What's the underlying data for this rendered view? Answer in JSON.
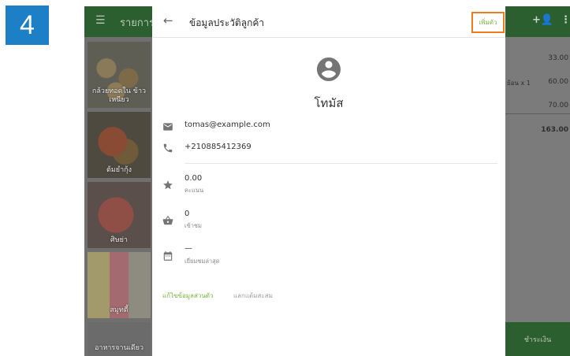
{
  "step_badge": "4",
  "background": {
    "menu_icon": "hamburger-icon",
    "title": "รายการ",
    "add_user_icon": "person-add-icon",
    "more_icon": "more-vertical-icon",
    "menu_items": [
      {
        "label": "กล้วยทอดใน ข้าวเหนียว"
      },
      {
        "label": "ต้มยำกุ้ง"
      },
      {
        "label": "ศิษย่า"
      },
      {
        "label": "สมูทตี้"
      },
      {
        "label": "อาหารจานเดียว"
      }
    ],
    "order_lines": [
      {
        "price": "33.00"
      },
      {
        "note": "ย้อน x 1",
        "price": "60.00"
      },
      {
        "price": "70.00"
      }
    ],
    "total": "163.00",
    "pay_label": "ชำระเงิน"
  },
  "dialog": {
    "back_icon": "arrow-back-icon",
    "title": "ข้อมูลประวัติลูกค้า",
    "add_button": "เพิ่มตัว",
    "avatar_icon": "account-circle-icon",
    "customer_name": "โทมัส",
    "email": "tomas@example.com",
    "phone": "+210885412369",
    "points": {
      "value": "0.00",
      "label": "คะแนน",
      "icon": "star-icon"
    },
    "visits": {
      "value": "0",
      "label": "เข้าชม",
      "icon": "basket-icon"
    },
    "last_visit": {
      "value": "—",
      "label": "เยี่ยมชมล่าสุด",
      "icon": "calendar-icon"
    },
    "email_icon": "email-icon",
    "phone_icon": "phone-icon",
    "edit_link": "แก้ไขข้อมูลส่วนตัว",
    "redeem_link": "แลกแต้มสะสม"
  },
  "colors": {
    "accent_green": "#7cb342",
    "highlight_orange": "#ee7d1f",
    "badge_blue": "#1d7fc6",
    "header_green": "#2b5f2f"
  }
}
